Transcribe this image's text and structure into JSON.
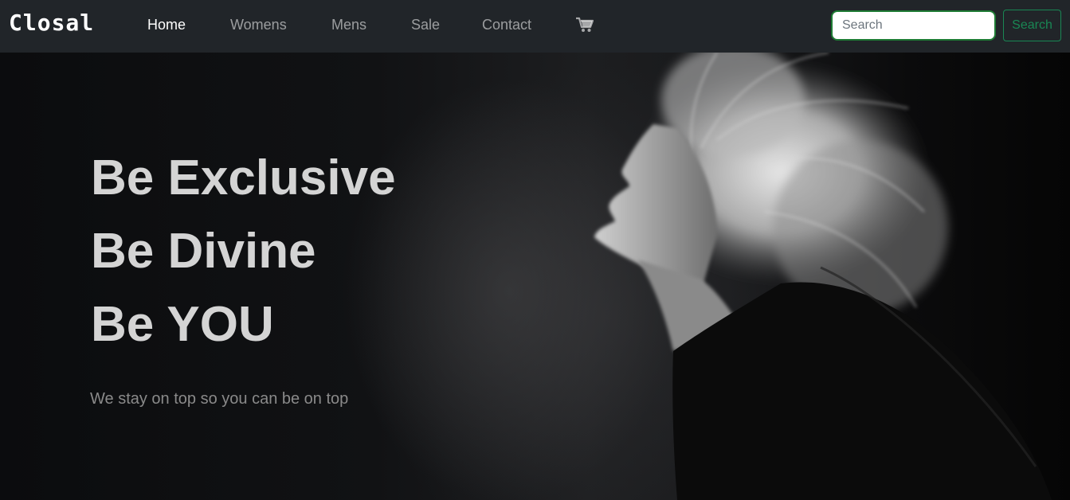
{
  "brand": "Closal",
  "nav": {
    "items": [
      {
        "label": "Home",
        "active": true
      },
      {
        "label": "Womens",
        "active": false
      },
      {
        "label": "Mens",
        "active": false
      },
      {
        "label": "Sale",
        "active": false
      },
      {
        "label": "Contact",
        "active": false
      }
    ],
    "cart_icon": "shopping-cart-icon"
  },
  "search": {
    "placeholder": "Search",
    "value": "",
    "button_label": "Search"
  },
  "hero": {
    "lines": [
      "Be Exclusive",
      "Be Divine",
      "Be YOU"
    ],
    "tagline": "We stay on top so you can be on top"
  },
  "colors": {
    "navbar_bg": "#212529",
    "accent_green": "#198754",
    "headline": "#d4d4d4"
  }
}
